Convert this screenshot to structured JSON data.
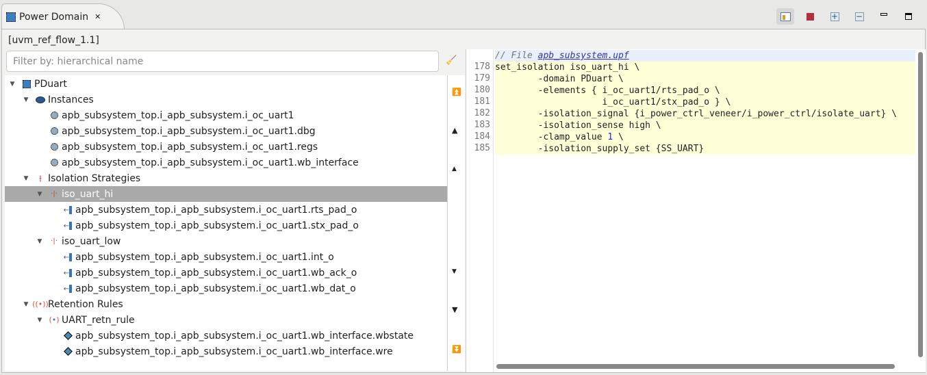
{
  "tab": {
    "title": "Power Domain",
    "close": "✕"
  },
  "toolbar": {
    "icons": [
      "show-info-icon",
      "stop-icon",
      "expand-all-icon",
      "collapse-all-icon",
      "minimize-icon",
      "maximize-icon"
    ]
  },
  "context": "[uvm_ref_flow_1.1]",
  "filter": {
    "placeholder": "Filter by: hierarchical name",
    "value": ""
  },
  "tree": [
    {
      "label": "PDuart",
      "level": 0,
      "expanded": true,
      "icon": "power-domain-icon"
    },
    {
      "label": "Instances",
      "level": 1,
      "expanded": true,
      "icon": "instances-icon"
    },
    {
      "label": "apb_subsystem_top.i_apb_subsystem.i_oc_uart1",
      "level": 2,
      "icon": "instance-icon"
    },
    {
      "label": "apb_subsystem_top.i_apb_subsystem.i_oc_uart1.dbg",
      "level": 2,
      "icon": "instance-icon"
    },
    {
      "label": "apb_subsystem_top.i_apb_subsystem.i_oc_uart1.regs",
      "level": 2,
      "icon": "instance-icon"
    },
    {
      "label": "apb_subsystem_top.i_apb_subsystem.i_oc_uart1.wb_interface",
      "level": 2,
      "icon": "instance-icon"
    },
    {
      "label": "Isolation Strategies",
      "level": 1,
      "expanded": true,
      "icon": "isolation-strategies-icon"
    },
    {
      "label": "iso_uart_hi",
      "level": 2,
      "expanded": true,
      "icon": "isolation-icon",
      "selected": true
    },
    {
      "label": "apb_subsystem_top.i_apb_subsystem.i_oc_uart1.rts_pad_o",
      "level": 3,
      "icon": "port-icon"
    },
    {
      "label": "apb_subsystem_top.i_apb_subsystem.i_oc_uart1.stx_pad_o",
      "level": 3,
      "icon": "port-icon"
    },
    {
      "label": "iso_uart_low",
      "level": 2,
      "expanded": true,
      "icon": "isolation-icon"
    },
    {
      "label": "apb_subsystem_top.i_apb_subsystem.i_oc_uart1.int_o",
      "level": 3,
      "icon": "port-icon"
    },
    {
      "label": "apb_subsystem_top.i_apb_subsystem.i_oc_uart1.wb_ack_o",
      "level": 3,
      "icon": "port-icon"
    },
    {
      "label": "apb_subsystem_top.i_apb_subsystem.i_oc_uart1.wb_dat_o",
      "level": 3,
      "icon": "port-icon"
    },
    {
      "label": "Retention Rules",
      "level": 1,
      "expanded": true,
      "icon": "retention-rules-icon"
    },
    {
      "label": "UART_retn_rule",
      "level": 2,
      "expanded": true,
      "icon": "retention-icon"
    },
    {
      "label": "apb_subsystem_top.i_apb_subsystem.i_oc_uart1.wb_interface.wbstate",
      "level": 3,
      "icon": "register-icon"
    },
    {
      "label": "apb_subsystem_top.i_apb_subsystem.i_oc_uart1.wb_interface.wre",
      "level": 3,
      "icon": "register-icon"
    }
  ],
  "editor": {
    "header_prefix": "// File ",
    "file_link": "apb_subsystem.upf",
    "lines": [
      {
        "n": "178",
        "code": "set_isolation iso_uart_hi \\"
      },
      {
        "n": "179",
        "code": "        -domain PDuart \\"
      },
      {
        "n": "180",
        "code": "        -elements { i_oc_uart1/rts_pad_o \\"
      },
      {
        "n": "181",
        "code": "                    i_oc_uart1/stx_pad_o } \\"
      },
      {
        "n": "182",
        "code": "        -isolation_signal {i_power_ctrl_veneer/i_power_ctrl/isolate_uart} \\"
      },
      {
        "n": "183",
        "code": "        -isolation_sense high \\"
      },
      {
        "n": "184",
        "code": "        -clamp_value ",
        "num": "1",
        "rest": " \\"
      },
      {
        "n": "185",
        "code": "        -isolation_supply_set {SS_UART}"
      }
    ]
  },
  "colors": {
    "selection": "#a9a9a9",
    "code_highlight": "#ffffd8",
    "header_bg": "#e8f0fc"
  }
}
